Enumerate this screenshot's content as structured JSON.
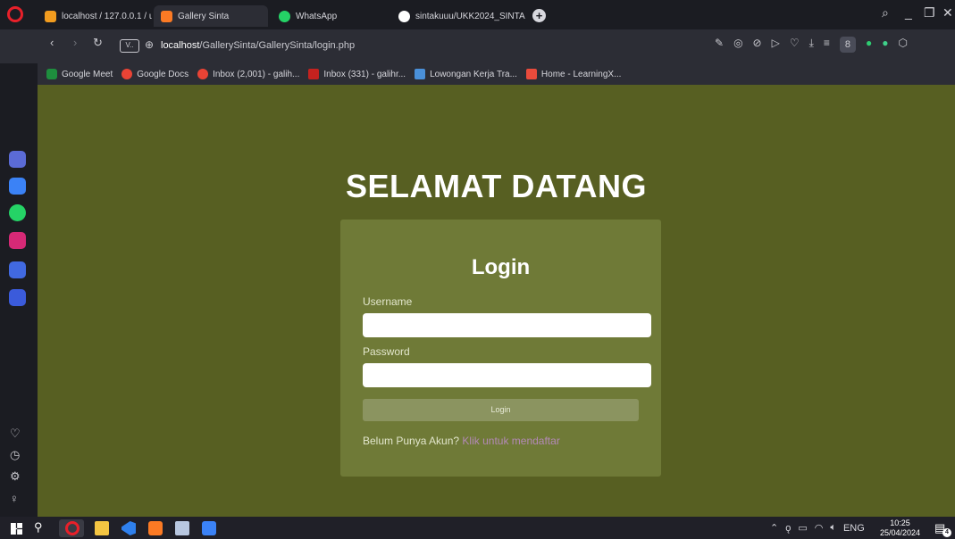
{
  "tabs": [
    {
      "label": "localhost / 127.0.0.1 / ukk...",
      "icon": "phpmyadmin-icon"
    },
    {
      "label": "Gallery Sinta",
      "icon": "xampp-icon"
    },
    {
      "label": "WhatsApp",
      "icon": "whatsapp-icon"
    },
    {
      "label": "sintakuuu/UKK2024_SINTA",
      "icon": "github-icon"
    }
  ],
  "address": {
    "vpn_label": "V..",
    "host": "localhost",
    "path": "/GallerySinta/GallerySinta/login.php"
  },
  "bookmarks": [
    {
      "label": "Google Meet",
      "color": "#1e8e3e"
    },
    {
      "label": "Google Docs",
      "color": "#ea4335"
    },
    {
      "label": "Inbox (2,001) - galih...",
      "color": "#ea4335"
    },
    {
      "label": "Inbox (331) - galihr...",
      "color": "#c5221f"
    },
    {
      "label": "Lowongan Kerja Tra...",
      "color": "#4a90d9"
    },
    {
      "label": "Home - LearningX...",
      "color": "#e94b3c"
    }
  ],
  "page": {
    "welcome": "SELAMAT DATANG",
    "login_title": "Login",
    "username_label": "Username",
    "username_value": "",
    "password_label": "Password",
    "password_value": "",
    "login_button": "Login",
    "register_prompt": "Belum Punya Akun?",
    "register_link": "Klik untuk mendaftar"
  },
  "taskbar": {
    "lang": "ENG",
    "time": "10:25",
    "date": "25/04/2024",
    "notif_count": "4"
  },
  "colors": {
    "page_bg": "#575f22",
    "card_bg": "#6f7a37",
    "button_bg": "#8b9460",
    "link": "#b389b6"
  }
}
